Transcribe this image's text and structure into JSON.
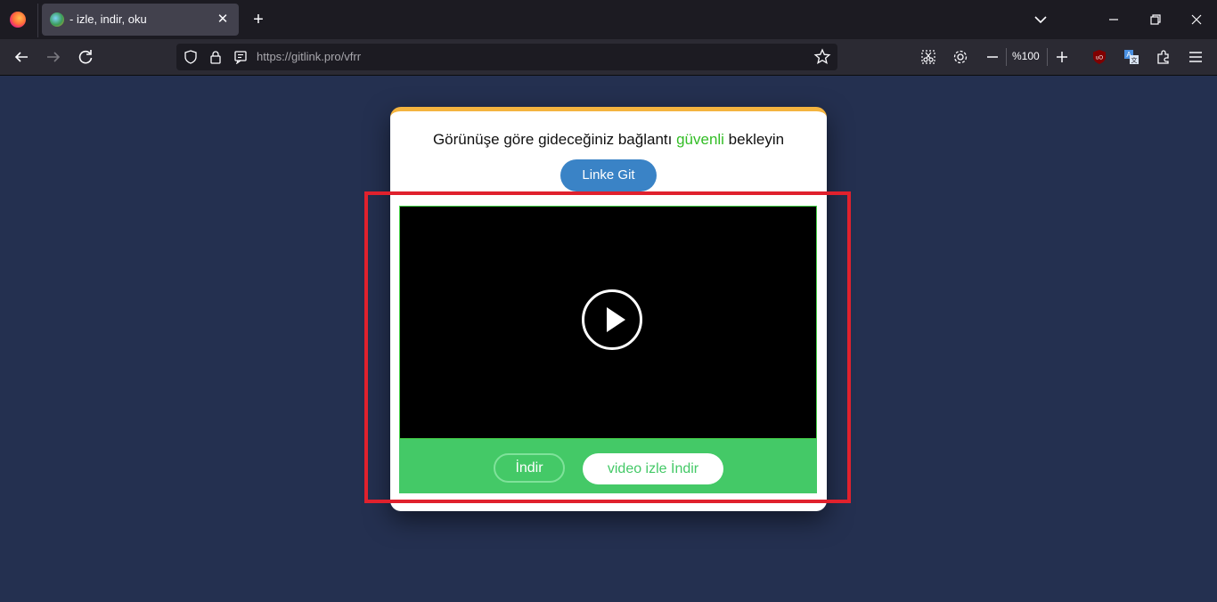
{
  "browser": {
    "tab": {
      "title": "- izle, indir, oku"
    },
    "url": {
      "domain": "https://gitlink.pro",
      "path": "/vfrr"
    },
    "zoom": "%100"
  },
  "page": {
    "heading_before": "Görünüşe göre gideceğiniz bağlantı ",
    "heading_safe": "güvenli",
    "heading_after": " bekleyin",
    "link_button": "Linke Git",
    "download_button": "İndir",
    "video_download_button": "video izle İndir"
  },
  "colors": {
    "accent_orange": "#f4b43f",
    "safe_green": "#33bd26",
    "button_blue": "#3a83c6",
    "bar_green": "#44c967",
    "highlight_red": "#e0212d",
    "page_bg": "#243050"
  }
}
